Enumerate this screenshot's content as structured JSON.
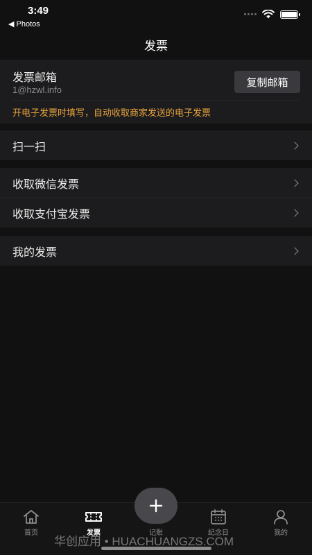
{
  "status_bar": {
    "time": "3:49",
    "back_app": "◀ Photos",
    "battery_level": 1.0
  },
  "nav": {
    "title": "发票"
  },
  "email_card": {
    "label": "发票邮箱",
    "email": "1@hzwl.info",
    "copy_label": "复制邮箱",
    "note": "开电子发票时填写，自动收取商家发送的电子发票"
  },
  "groups": [
    {
      "items": [
        {
          "label": "扫一扫"
        }
      ]
    },
    {
      "items": [
        {
          "label": "收取微信发票"
        },
        {
          "label": "收取支付宝发票"
        }
      ]
    },
    {
      "items": [
        {
          "label": "我的发票"
        }
      ]
    }
  ],
  "tab_bar": {
    "active": "invoice",
    "tabs": [
      {
        "key": "home",
        "label": "首页",
        "icon": "home-icon"
      },
      {
        "key": "invoice",
        "label": "发票",
        "icon": "ticket-icon"
      },
      {
        "key": "bookkeeping",
        "label": "记账",
        "icon": "plus-icon"
      },
      {
        "key": "anniversary",
        "label": "纪念日",
        "icon": "calendar-icon"
      },
      {
        "key": "mine",
        "label": "我的",
        "icon": "person-icon"
      }
    ]
  },
  "watermark": "华创应用 • HUACHUANGZS.COM",
  "colors": {
    "background": "#111111",
    "card": "#1c1c1e",
    "accent_note": "#e8a33c",
    "button": "#3a3a3e"
  }
}
